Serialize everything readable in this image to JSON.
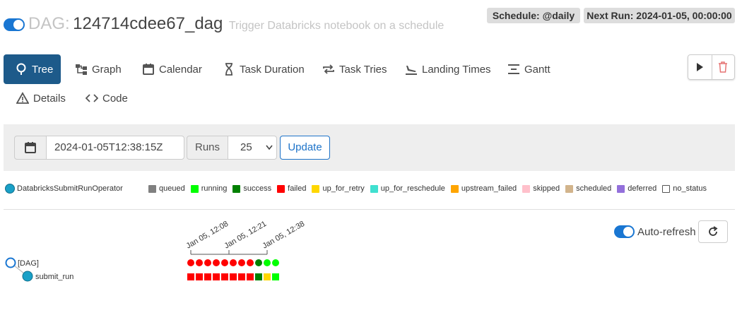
{
  "header": {
    "dag_prefix": "DAG:",
    "dag_id": "124714cdee67_dag",
    "description": "Trigger Databricks notebook on a schedule",
    "schedule": "Schedule: @daily",
    "next_run": "Next Run: 2024-01-05, 00:00:00"
  },
  "tabs": [
    {
      "label": "Tree",
      "icon": "tree-icon",
      "active": true
    },
    {
      "label": "Graph",
      "icon": "graph-icon"
    },
    {
      "label": "Calendar",
      "icon": "calendar-icon"
    },
    {
      "label": "Task Duration",
      "icon": "hourglass-icon"
    },
    {
      "label": "Task Tries",
      "icon": "repeat-icon"
    },
    {
      "label": "Landing Times",
      "icon": "plane-landing-icon"
    },
    {
      "label": "Gantt",
      "icon": "gantt-icon"
    },
    {
      "label": "Details",
      "icon": "warning-triangle-icon"
    },
    {
      "label": "Code",
      "icon": "code-icon"
    }
  ],
  "actions": {
    "trigger_icon": "play-icon",
    "delete_icon": "trash-icon"
  },
  "controls": {
    "date_value": "2024-01-05T12:38:15Z",
    "runs_label": "Runs",
    "runs_value": "25",
    "update_label": "Update"
  },
  "legend": {
    "operator": "DatabricksSubmitRunOperator",
    "operator_color": "#19a0c7",
    "states": [
      {
        "name": "queued",
        "color": "#808080"
      },
      {
        "name": "running",
        "color": "#00ff00"
      },
      {
        "name": "success",
        "color": "#008000"
      },
      {
        "name": "failed",
        "color": "#ff0000"
      },
      {
        "name": "up_for_retry",
        "color": "#ffd700"
      },
      {
        "name": "up_for_reschedule",
        "color": "#40e0d0"
      },
      {
        "name": "upstream_failed",
        "color": "#ffa500"
      },
      {
        "name": "skipped",
        "color": "#ffc0cb"
      },
      {
        "name": "scheduled",
        "color": "#d2b48c"
      },
      {
        "name": "deferred",
        "color": "#9370db"
      },
      {
        "name": "no_status",
        "color": "#ffffff"
      }
    ]
  },
  "tree": {
    "auto_refresh_label": "Auto-refresh",
    "time_labels": [
      "Jan 05, 12:08",
      "Jan 05, 12:21",
      "Jan 05, 12:38"
    ],
    "nodes": [
      {
        "label": "[DAG]"
      },
      {
        "label": "submit_run"
      }
    ],
    "dag_runs": [
      "failed",
      "failed",
      "failed",
      "failed",
      "failed",
      "failed",
      "failed",
      "failed",
      "success",
      "running",
      "running"
    ],
    "task_instances": [
      "failed",
      "failed",
      "failed",
      "failed",
      "failed",
      "failed",
      "failed",
      "failed",
      "success",
      "up_for_retry",
      "running"
    ]
  }
}
